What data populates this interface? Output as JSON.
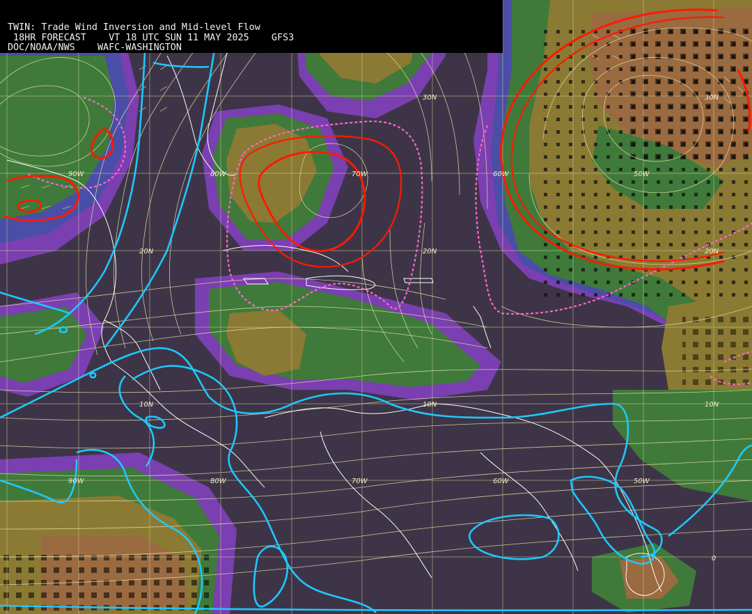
{
  "header": {
    "line1": "TWIN: Trade Wind Inversion and Mid-level Flow",
    "line2": " 18HR FORECAST    VT 18 UTC SUN 11 MAY 2025    GFS3",
    "line3": "DOC/NOAA/NWS    WAFC-WASHINGTON"
  },
  "grid_labels": {
    "lat30_mid": "30N",
    "lat30_right": "30N",
    "lat20_left": "20N",
    "lat20_mid": "20N",
    "lat20_right": "20N",
    "lat10_left": "10N",
    "lat10_mid": "10N",
    "lat10_right": "10N",
    "lat0": "0",
    "lon90_top": "90W",
    "lon80_top": "80W",
    "lon70_top": "70W",
    "lon60_top": "60W",
    "lon50_top": "50W",
    "lon90_bot": "90W",
    "lon80_bot": "80W",
    "lon70_bot": "70W",
    "lon60_bot": "60W",
    "lon50_bot": "50W"
  },
  "colors": {
    "background": "#3d3547",
    "purple_band": "#7a3fb0",
    "blue_band": "#4a4ea6",
    "green_band": "#3f7a3a",
    "dark_green": "#2f6330",
    "olive": "#8a7a33",
    "brown": "#9a6a40",
    "streamline": "#e8e0a8",
    "coastline": "#ffffff",
    "red_contour": "#ff1a00",
    "pink_dashed": "#ff66cc",
    "cyan_contour": "#1ec8ff"
  }
}
